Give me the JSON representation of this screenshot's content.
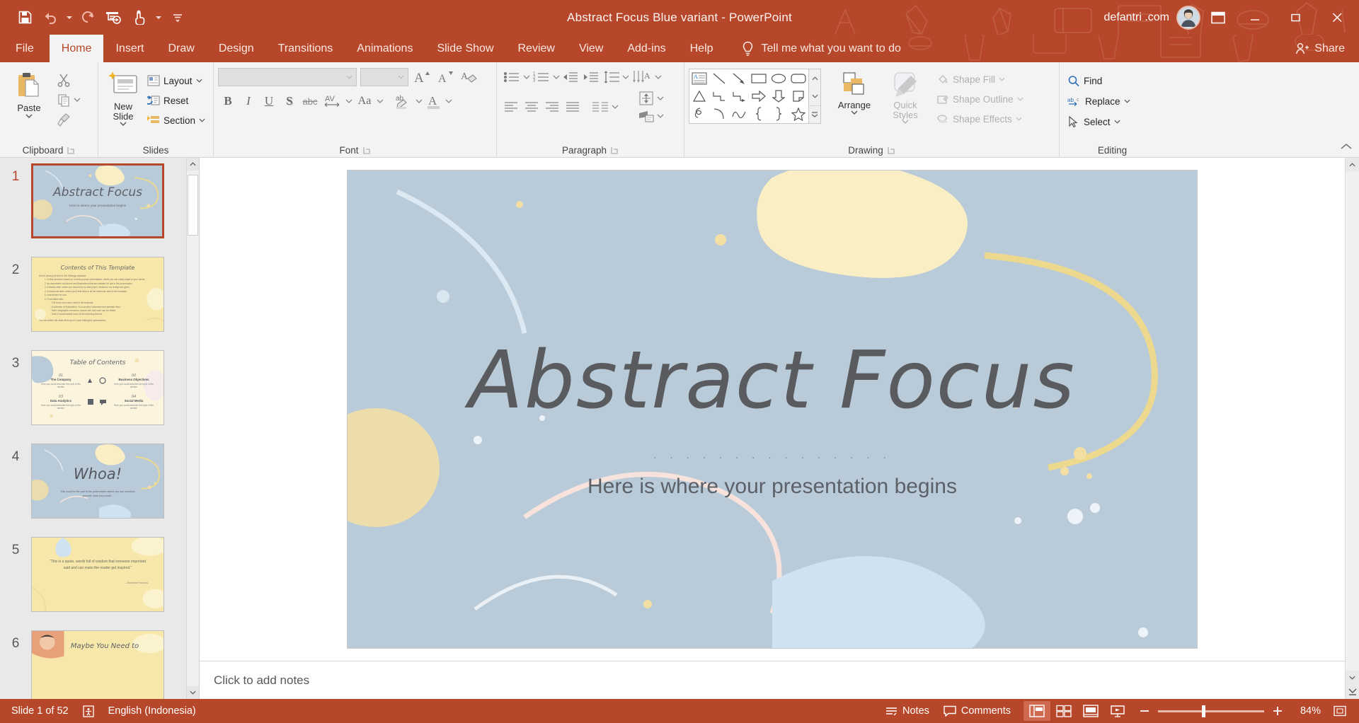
{
  "window": {
    "title": "Abstract Focus Blue variant  -  PowerPoint",
    "account": "defantri .com",
    "minimize": "Minimize",
    "restore": "Restore Down",
    "close": "Close",
    "ribbon_display_options": "Ribbon Display Options",
    "accent_color": "#b7472a"
  },
  "quick_access": {
    "save": "Save",
    "undo": "Undo",
    "redo": "Repeat",
    "start_from_beginning": "Start From Beginning",
    "touch_mouse_mode": "Touch/Mouse Mode",
    "customize": "Customize Quick Access Toolbar"
  },
  "tabs": [
    {
      "label": "File",
      "active": false
    },
    {
      "label": "Home",
      "active": true
    },
    {
      "label": "Insert",
      "active": false
    },
    {
      "label": "Draw",
      "active": false
    },
    {
      "label": "Design",
      "active": false
    },
    {
      "label": "Transitions",
      "active": false
    },
    {
      "label": "Animations",
      "active": false
    },
    {
      "label": "Slide Show",
      "active": false
    },
    {
      "label": "Review",
      "active": false
    },
    {
      "label": "View",
      "active": false
    },
    {
      "label": "Add-ins",
      "active": false
    },
    {
      "label": "Help",
      "active": false
    }
  ],
  "tellme": {
    "label": "Tell me what you want to do",
    "icon": "lightbulb-icon"
  },
  "share": {
    "label": "Share",
    "icon": "share-person-icon"
  },
  "ribbon": {
    "clipboard": {
      "group_label": "Clipboard",
      "paste": "Paste",
      "cut": "Cut",
      "copy": "Copy",
      "format_painter": "Format Painter"
    },
    "slides": {
      "group_label": "Slides",
      "new_slide": "New Slide",
      "layout": "Layout",
      "reset": "Reset",
      "section": "Section"
    },
    "font": {
      "group_label": "Font",
      "font_name": "",
      "font_size": "",
      "bold": "B",
      "italic": "I",
      "underline": "U",
      "shadow": "S",
      "strikethrough": "abc",
      "character_spacing": "AV",
      "change_case": "Aa",
      "increase_font_size": "A",
      "decrease_font_size": "A",
      "clear_formatting": "Clear All Formatting",
      "text_highlight_color": "Text Highlight Color",
      "font_color": "Font Color"
    },
    "paragraph": {
      "group_label": "Paragraph",
      "bullets": "Bullets",
      "numbering": "Numbering",
      "decrease_indent": "Decrease Indent",
      "increase_indent": "Increase Indent",
      "line_spacing": "Line Spacing",
      "align_left": "Align Left",
      "center": "Center",
      "align_right": "Align Right",
      "justify": "Justify",
      "columns": "Columns",
      "text_direction": "Text Direction",
      "align_text": "Align Text",
      "convert_to_smartart": "Convert to SmartArt"
    },
    "drawing": {
      "group_label": "Drawing",
      "arrange": "Arrange",
      "quick_styles": "Quick Styles",
      "shape_fill": "Shape Fill",
      "shape_outline": "Shape Outline",
      "shape_effects": "Shape Effects",
      "shapes": [
        "text-box",
        "line",
        "arrow",
        "rectangle",
        "oval",
        "rounded-rectangle",
        "triangle",
        "elbow-connector",
        "elbow-arrow-connector",
        "right-arrow",
        "down-arrow",
        "folded-corner",
        "scribble",
        "arc",
        "wave",
        "left-brace",
        "right-brace",
        "star"
      ]
    },
    "editing": {
      "group_label": "Editing",
      "find": "Find",
      "replace": "Replace",
      "select": "Select"
    },
    "collapse_ribbon": "Collapse the Ribbon"
  },
  "slides_panel": {
    "slides": [
      {
        "number": "1",
        "selected": true,
        "theme": "blue",
        "title": "Abstract Focus",
        "subtitle": "Here is where your presentation begins"
      },
      {
        "number": "2",
        "selected": false,
        "theme": "yellow",
        "title": "Contents of This Template",
        "subtitle": "Here's what you'll find in this Slidesgo template:"
      },
      {
        "number": "3",
        "selected": false,
        "theme": "cream",
        "title": "Table of Contents",
        "items": [
          {
            "num": "01",
            "name": "The Company",
            "desc": "Here you could describe the topic of the section"
          },
          {
            "num": "02",
            "name": "Business Objectives",
            "desc": "Here you could describe the topic of the section"
          },
          {
            "num": "03",
            "name": "Data Analytics",
            "desc": "Here you could describe the topic of the section"
          },
          {
            "num": "04",
            "name": "Social Media",
            "desc": "Here you could describe the topic of the section"
          }
        ]
      },
      {
        "number": "4",
        "selected": false,
        "theme": "blue",
        "title": "Whoa!",
        "subtitle": "This could be the part of the presentation where you can introduce yourself, write your email..."
      },
      {
        "number": "5",
        "selected": false,
        "theme": "yellow",
        "title": "“This is a quote, words full of wisdom that someone important said and can make the reader get inspired.”",
        "subtitle": "—Someone Famous"
      },
      {
        "number": "6",
        "selected": false,
        "theme": "yellow",
        "title": "Maybe You Need to",
        "subtitle": ""
      }
    ]
  },
  "slide_view": {
    "title": "Abstract Focus",
    "dots": "· · · · · · · · · · · · · · ·",
    "subtitle": "Here is where your presentation begins"
  },
  "notes": {
    "placeholder": "Click to add notes"
  },
  "status": {
    "slide_counter": "Slide 1 of 52",
    "accessibility": "Accessibility Checker",
    "language": "English (Indonesia)",
    "notes_button": "Notes",
    "comments_button": "Comments",
    "views": [
      {
        "name": "normal-view",
        "active": true
      },
      {
        "name": "slide-sorter-view",
        "active": false
      },
      {
        "name": "reading-view",
        "active": false
      },
      {
        "name": "slide-show-view",
        "active": false
      }
    ],
    "zoom_out": "Zoom Out",
    "zoom_in": "Zoom In",
    "zoom_level": "84%",
    "fit_to_window": "Fit slide to current window"
  }
}
